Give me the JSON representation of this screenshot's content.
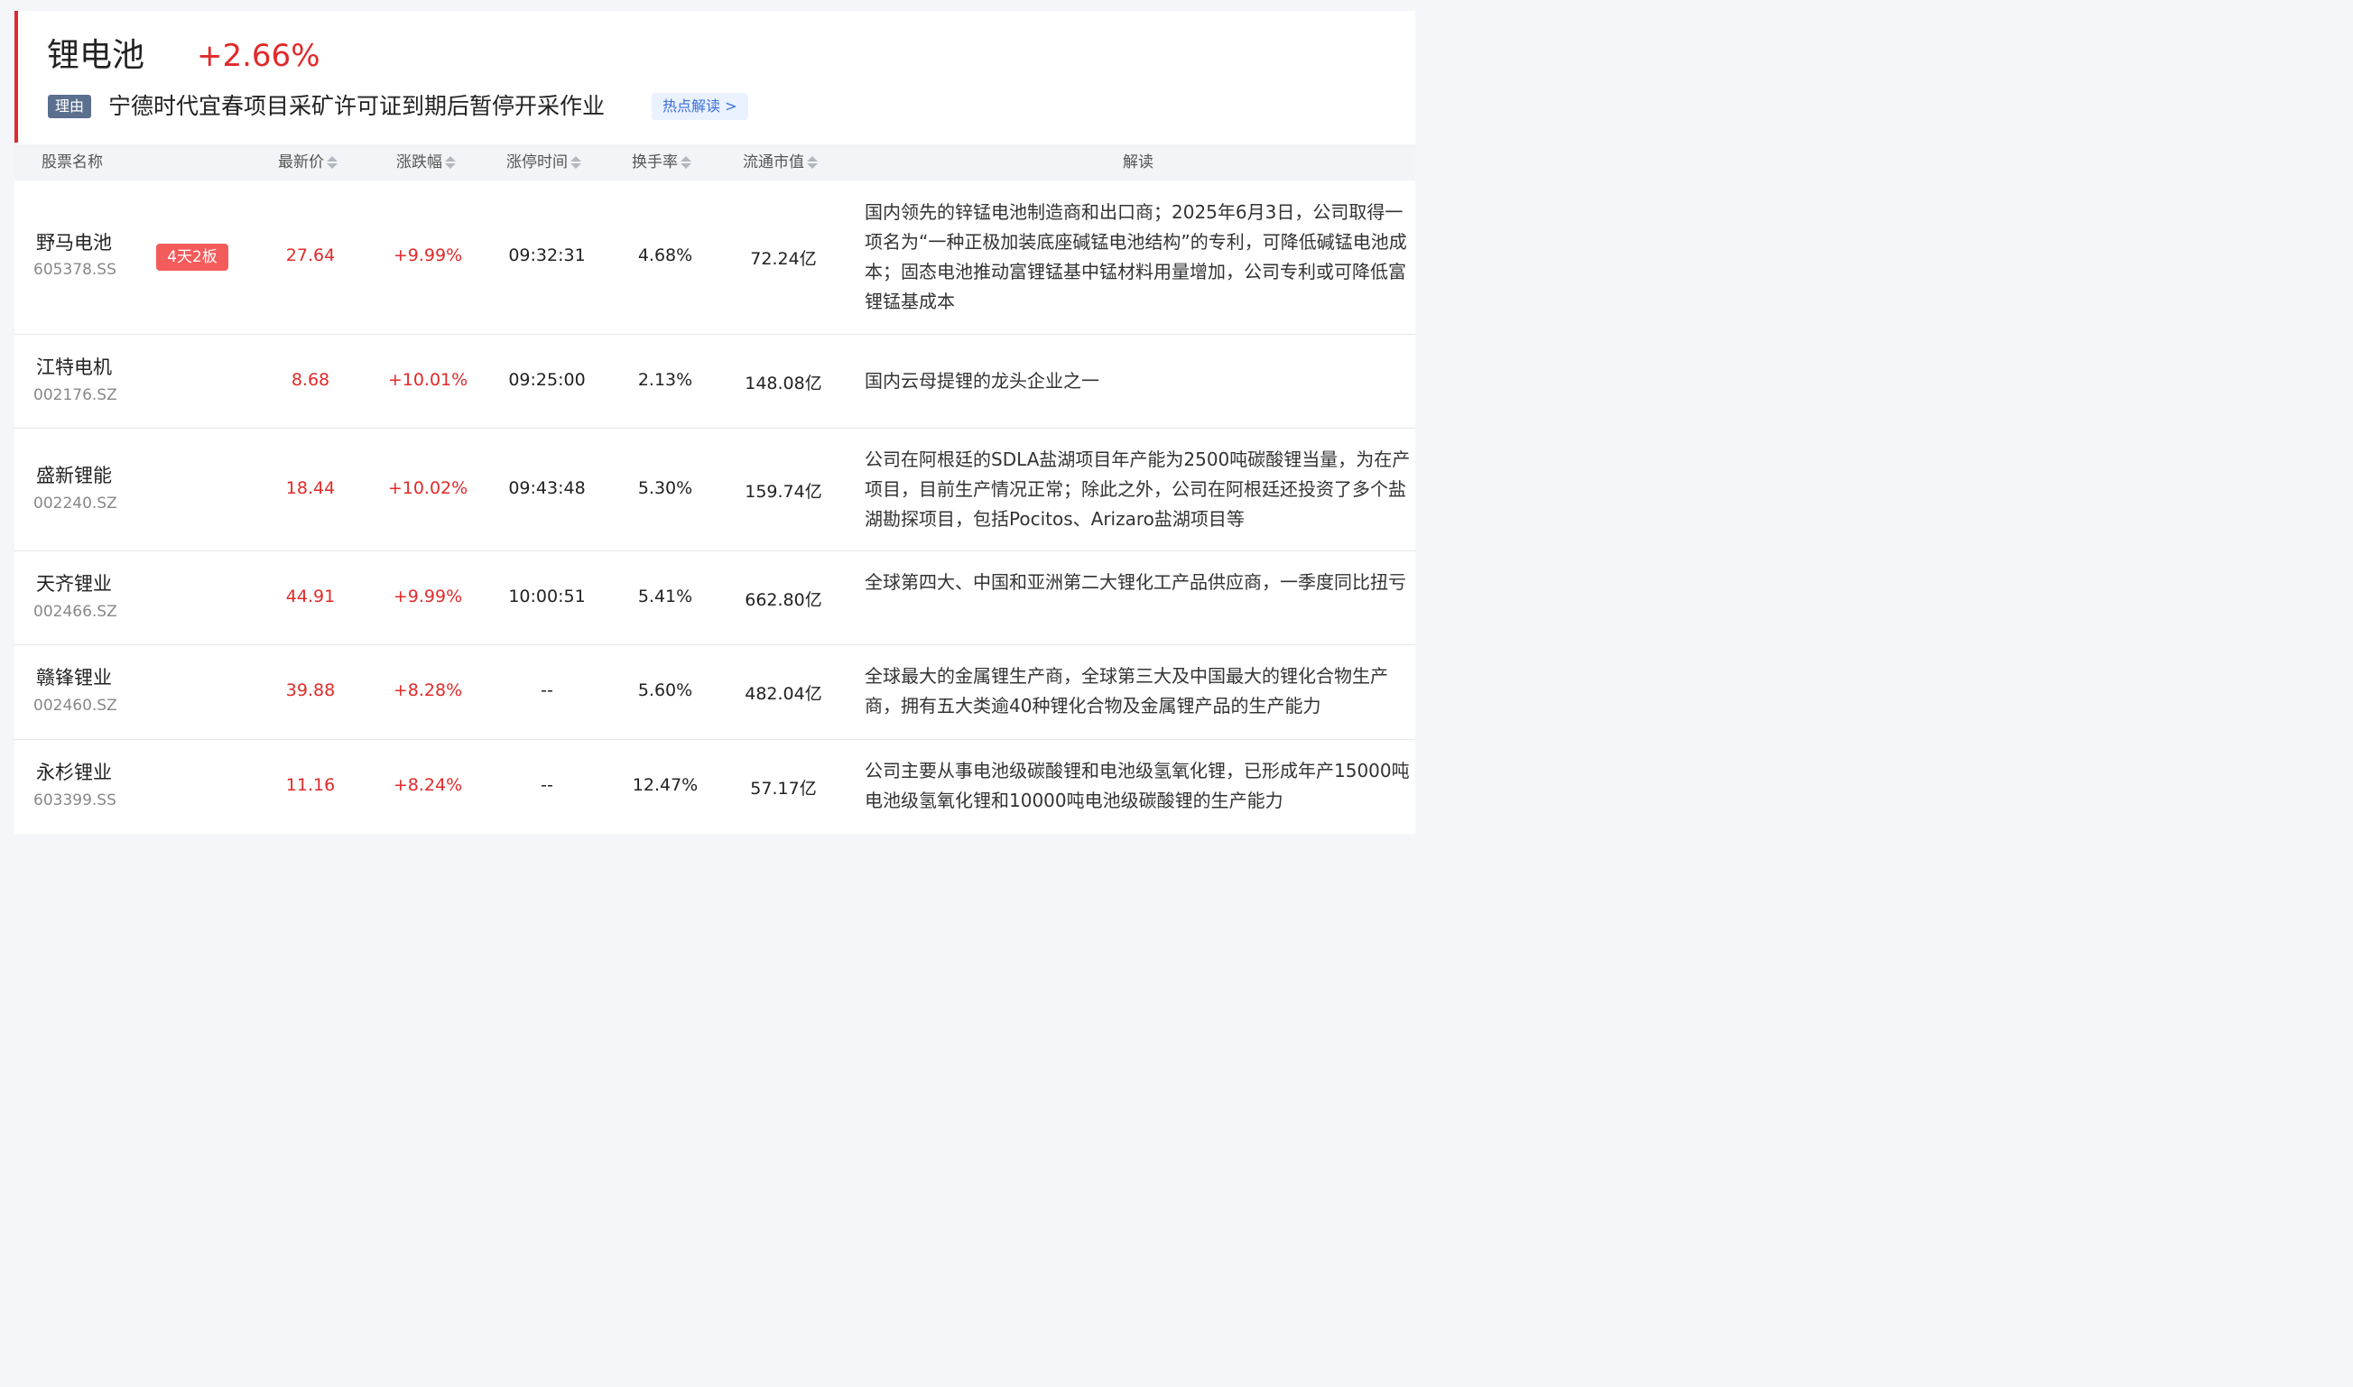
{
  "header": {
    "sector_name": "锂电池",
    "sector_change": "+2.66%",
    "reason_tag": "理由",
    "reason_text": "宁德时代宜春项目采矿许可证到期后暂停开采作业",
    "hot_link": "热点解读 >"
  },
  "columns": {
    "name": "股票名称",
    "price": "最新价",
    "change": "涨跌幅",
    "limit_time": "涨停时间",
    "turnover": "换手率",
    "mcap": "流通市值",
    "desc": "解读"
  },
  "rows": [
    {
      "name": "野马电池",
      "code": "605378.SS",
      "badge": "4天2板",
      "price": "27.64",
      "change": "+9.99%",
      "limit_time": "09:32:31",
      "turnover": "4.68%",
      "mcap": "72.24亿",
      "desc": "国内领先的锌锰电池制造商和出口商；2025年6月3日，公司取得一项名为“一种正极加装底座碱锰电池结构”的专利，可降低碱锰电池成本；固态电池推动富锂锰基中锰材料用量增加，公司专利或可降低富锂锰基成本"
    },
    {
      "name": "江特电机",
      "code": "002176.SZ",
      "price": "8.68",
      "change": "+10.01%",
      "limit_time": "09:25:00",
      "turnover": "2.13%",
      "mcap": "148.08亿",
      "desc": "国内云母提锂的龙头企业之一"
    },
    {
      "name": "盛新锂能",
      "code": "002240.SZ",
      "price": "18.44",
      "change": "+10.02%",
      "limit_time": "09:43:48",
      "turnover": "5.30%",
      "mcap": "159.74亿",
      "desc": "公司在阿根廷的SDLA盐湖项目年产能为2500吨碳酸锂当量，为在产项目，目前生产情况正常；除此之外，公司在阿根廷还投资了多个盐湖勘探项目，包括Pocitos、Arizaro盐湖项目等"
    },
    {
      "name": "天齐锂业",
      "code": "002466.SZ",
      "price": "44.91",
      "change": "+9.99%",
      "limit_time": "10:00:51",
      "turnover": "5.41%",
      "mcap": "662.80亿",
      "desc": "全球第四大、中国和亚洲第二大锂化工产品供应商，一季度同比扭亏"
    },
    {
      "name": "赣锋锂业",
      "code": "002460.SZ",
      "price": "39.88",
      "change": "+8.28%",
      "limit_time": "--",
      "turnover": "5.60%",
      "mcap": "482.04亿",
      "desc": "全球最大的金属锂生产商，全球第三大及中国最大的锂化合物生产商，拥有五大类逾40种锂化合物及金属锂产品的生产能力"
    },
    {
      "name": "永杉锂业",
      "code": "603399.SS",
      "price": "11.16",
      "change": "+8.24%",
      "limit_time": "--",
      "turnover": "12.47%",
      "mcap": "57.17亿",
      "desc": "公司主要从事电池级碳酸锂和电池级氢氧化锂，已形成年产15000吨电池级氢氧化锂和10000吨电池级碳酸锂的生产能力"
    }
  ]
}
